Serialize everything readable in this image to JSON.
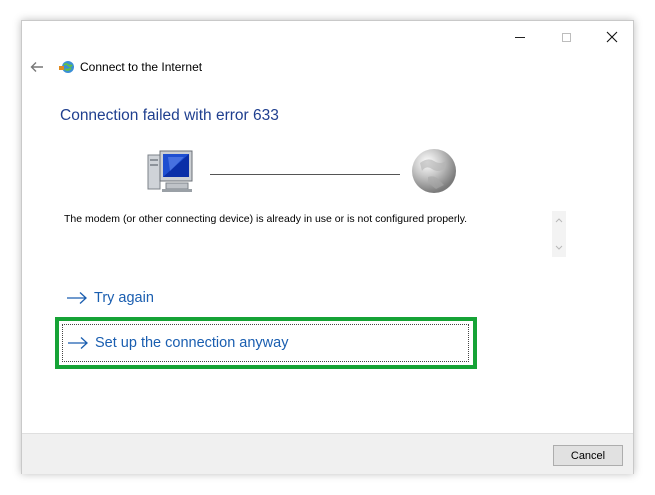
{
  "window": {
    "title": "Connect to the Internet",
    "heading": "Connection failed with error 633",
    "message": "The modem (or other connecting device) is already in use or is not configured properly."
  },
  "actions": {
    "try_again": "Try again",
    "setup_anyway": "Set up the connection anyway"
  },
  "footer": {
    "cancel_label": "Cancel"
  },
  "colors": {
    "heading": "#1f3f8f",
    "link": "#1a5eb0",
    "highlight": "#16a336",
    "footer_bg": "#f0f0f0"
  },
  "icons": {
    "back": "back-arrow-icon",
    "app": "network-connection-icon",
    "computer": "computer-icon",
    "globe": "globe-icon",
    "link_arrow": "arrow-right-icon",
    "minimize": "minimize-icon",
    "maximize": "maximize-icon",
    "close": "close-icon"
  }
}
